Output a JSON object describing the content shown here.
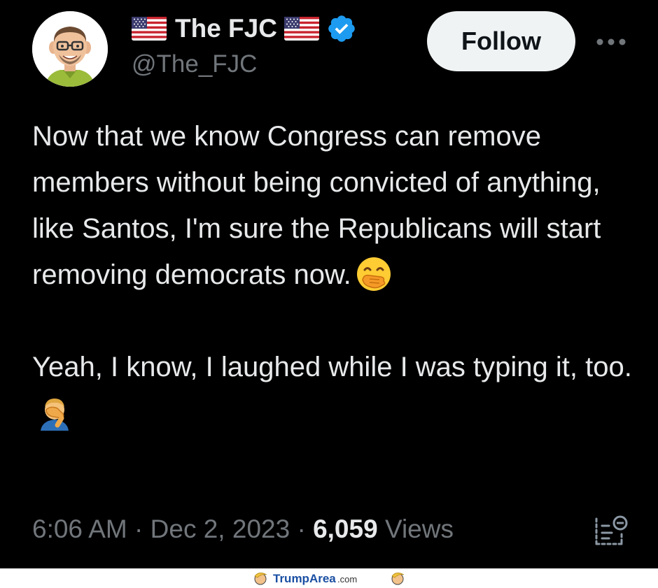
{
  "tweet": {
    "author": {
      "display_name": "The FJC",
      "handle": "@The_FJC",
      "verified": true,
      "avatar_icon": "cartoon-man-avatar-icon"
    },
    "follow_label": "Follow",
    "more_icon": "more-horizontal-icon",
    "text": {
      "paragraph_1": "Now that we know Congress can remove members without being convicted of anything, like Santos, I'm sure the Republicans will start removing democrats now.",
      "paragraph_1_emoji": "face-with-hand-over-mouth-emoji",
      "paragraph_2": "Yeah, I know, I laughed while I was typing it, too.",
      "paragraph_2_emoji": "man-facepalming-emoji"
    },
    "meta": {
      "time": "6:06 AM",
      "separator": "·",
      "date": "Dec 2, 2023",
      "views_count": "6,059",
      "views_label": "Views"
    },
    "analytics_icon": "analytics-icon"
  },
  "colors": {
    "background": "#000000",
    "text": "#e7e9ea",
    "secondary_text": "#71767b",
    "verified_blue": "#1d9bf0",
    "follow_bg": "#eff3f4"
  },
  "watermark": {
    "text": "TrumpArea.com"
  }
}
